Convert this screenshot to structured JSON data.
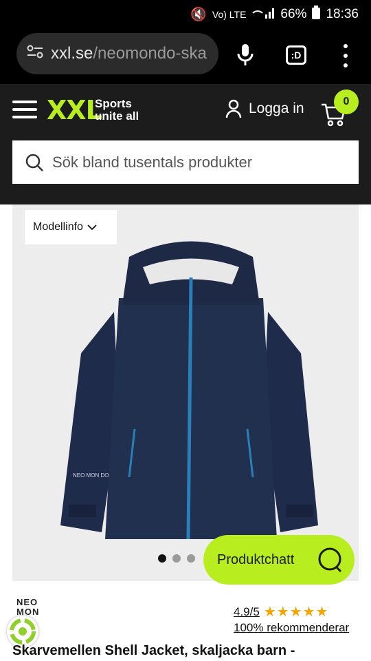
{
  "status": {
    "time": "18:36",
    "battery": "66%",
    "network": "Vo) LTE"
  },
  "browser": {
    "url_main": "xxl.se",
    "url_path": "/neomondo-ska",
    "tab_label": ":D"
  },
  "header": {
    "logo": "XXL",
    "tagline_line1": "Sports",
    "tagline_line2": "unite all",
    "login_label": "Logga in",
    "cart_count": "0",
    "accent_color": "#b8ee1f"
  },
  "search": {
    "placeholder": "Sök bland tusentals produkter"
  },
  "product": {
    "modellinfo_label": "Modellinfo",
    "chat_label": "Produktchatt",
    "brand_line1": "NEO",
    "brand_line2": "MON",
    "rating_score": "4.9/5",
    "stars": "★★★★★",
    "recommend_text": "100% rekommenderar",
    "title": "Skarvemellen Shell Jacket, skaljacka barn -",
    "jacket_print": "NEO MON DO"
  }
}
